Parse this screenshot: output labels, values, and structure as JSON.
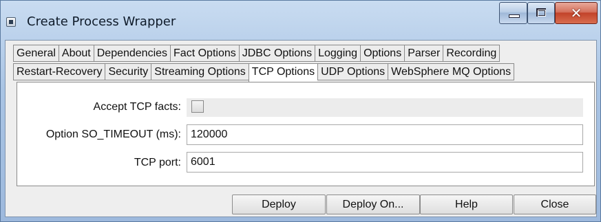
{
  "window": {
    "title": "Create Process Wrapper"
  },
  "tabs": {
    "row1": [
      "General",
      "About",
      "Dependencies",
      "Fact Options",
      "JDBC Options",
      "Logging",
      "Options",
      "Parser",
      "Recording"
    ],
    "row2": [
      "Restart-Recovery",
      "Security",
      "Streaming Options",
      "TCP Options",
      "UDP Options",
      "WebSphere MQ Options"
    ],
    "active": "TCP Options"
  },
  "form": {
    "accept_tcp_facts_label": "Accept TCP facts:",
    "accept_tcp_facts_checked": false,
    "so_timeout_label": "Option SO_TIMEOUT (ms):",
    "so_timeout_value": "120000",
    "tcp_port_label": "TCP port:",
    "tcp_port_value": "6001"
  },
  "buttons": {
    "deploy": "Deploy",
    "deploy_on": "Deploy On...",
    "help": "Help",
    "close": "Close"
  },
  "icons": {
    "app": "app-window-icon",
    "minimize": "minimize-icon",
    "maximize": "maximize-icon",
    "close": "close-icon"
  },
  "colors": {
    "close_button": "#c2432a",
    "titlebar": "#a9c4e4"
  }
}
